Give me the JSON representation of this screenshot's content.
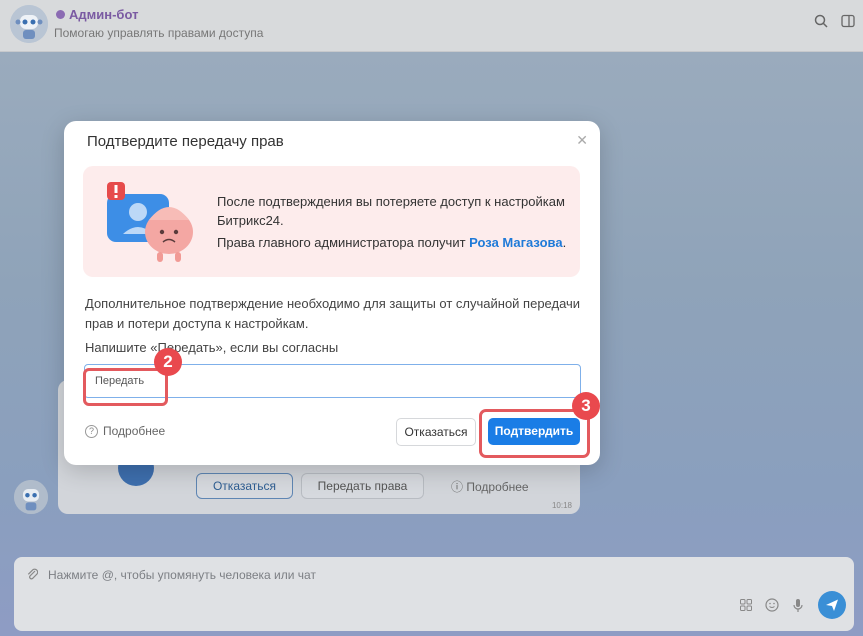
{
  "header": {
    "title": "Админ-бот",
    "subtitle": "Помогаю управлять правами доступа"
  },
  "background_card": {
    "reject_label": "Отказаться",
    "transfer_label": "Передать права",
    "more_label": "Подробнее",
    "time": "10:18"
  },
  "input_bar": {
    "placeholder": "Нажмите @, чтобы упомянуть человека или чат"
  },
  "modal": {
    "title": "Подтвердите передачу прав",
    "warning_text": "После подтверждения вы потеряете доступ к настройкам Битрикс24.",
    "warning_receiver_prefix": "Права главного администратора получит ",
    "receiver_name": "Роза Магазова",
    "warning_receiver_suffix": ".",
    "description": "Дополнительное подтверждение необходимо для защиты от случайной передачи прав и потери доступа к настройкам.",
    "prompt": "Напишите «Передать», если вы согласны",
    "field_value": "Передать",
    "more_label": "Подробнее",
    "cancel_label": "Отказаться",
    "confirm_label": "Подтвердить"
  },
  "annotations": {
    "step_field": "2",
    "step_confirm": "3"
  },
  "colors": {
    "accent": "#1a7de6",
    "highlight": "#e35a5e",
    "warning_bg": "#fdecec"
  }
}
